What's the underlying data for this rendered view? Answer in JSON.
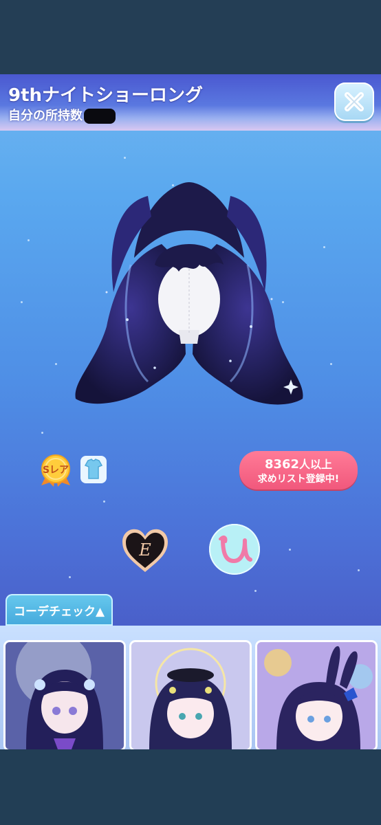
{
  "item": {
    "title": "9thナイトショーロング",
    "owned_label": "自分の所持数"
  },
  "badges": {
    "rarity_label": "Sレア",
    "rarity_icon": "s-rare-badge-icon",
    "category_icon": "clothes-category-icon"
  },
  "wishlist": {
    "count_number": "8362",
    "count_suffix": "人以上",
    "text": "求めリスト登録中!"
  },
  "emblems": {
    "left_icon": "heart-e-emblem-icon",
    "right_icon": "u-circle-emblem-icon"
  },
  "coordinate": {
    "tab_label": "コーデチェック▲",
    "thumbnails": [
      "coordinate-thumbnail-1",
      "coordinate-thumbnail-2",
      "coordinate-thumbnail-3"
    ]
  },
  "colors": {
    "header": "#4a58d0",
    "wish_pill": "#f1587c",
    "tab": "#45a9dc",
    "hair": "#1d1a4a"
  }
}
